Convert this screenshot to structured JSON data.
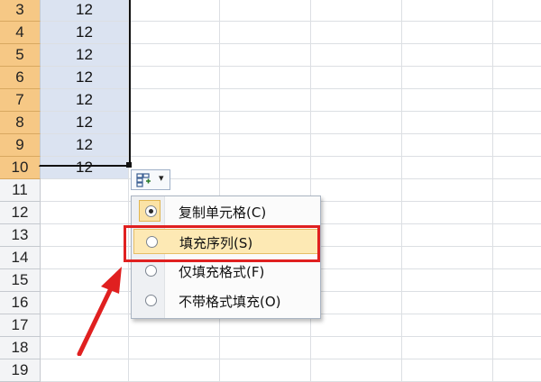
{
  "sheet": {
    "rows": [
      {
        "num": "3",
        "value": "12",
        "selected": true
      },
      {
        "num": "4",
        "value": "12",
        "selected": true
      },
      {
        "num": "5",
        "value": "12",
        "selected": true
      },
      {
        "num": "6",
        "value": "12",
        "selected": true
      },
      {
        "num": "7",
        "value": "12",
        "selected": true
      },
      {
        "num": "8",
        "value": "12",
        "selected": true
      },
      {
        "num": "9",
        "value": "12",
        "selected": true
      },
      {
        "num": "10",
        "value": "12",
        "selected": true
      },
      {
        "num": "11",
        "value": "",
        "selected": false
      },
      {
        "num": "12",
        "value": "",
        "selected": false
      },
      {
        "num": "13",
        "value": "",
        "selected": false
      },
      {
        "num": "14",
        "value": "",
        "selected": false
      },
      {
        "num": "15",
        "value": "",
        "selected": false
      },
      {
        "num": "16",
        "value": "",
        "selected": false
      },
      {
        "num": "17",
        "value": "",
        "selected": false
      },
      {
        "num": "18",
        "value": "",
        "selected": false
      },
      {
        "num": "19",
        "value": "",
        "selected": false
      }
    ]
  },
  "autofill": {
    "icon": "autofill-options-icon",
    "dropdown_icon": "chevron-down-icon",
    "menu": {
      "items": [
        {
          "label": "复制单元格(C)",
          "name": "copy-cells",
          "selected": true
        },
        {
          "label": "填充序列(S)",
          "name": "fill-series",
          "selected": false,
          "highlighted": true
        },
        {
          "label": "仅填充格式(F)",
          "name": "fill-formatting-only",
          "selected": false
        },
        {
          "label": "不带格式填充(O)",
          "name": "fill-without-formatting",
          "selected": false
        }
      ]
    }
  },
  "annotation": {
    "highlight_color": "#e02020"
  }
}
